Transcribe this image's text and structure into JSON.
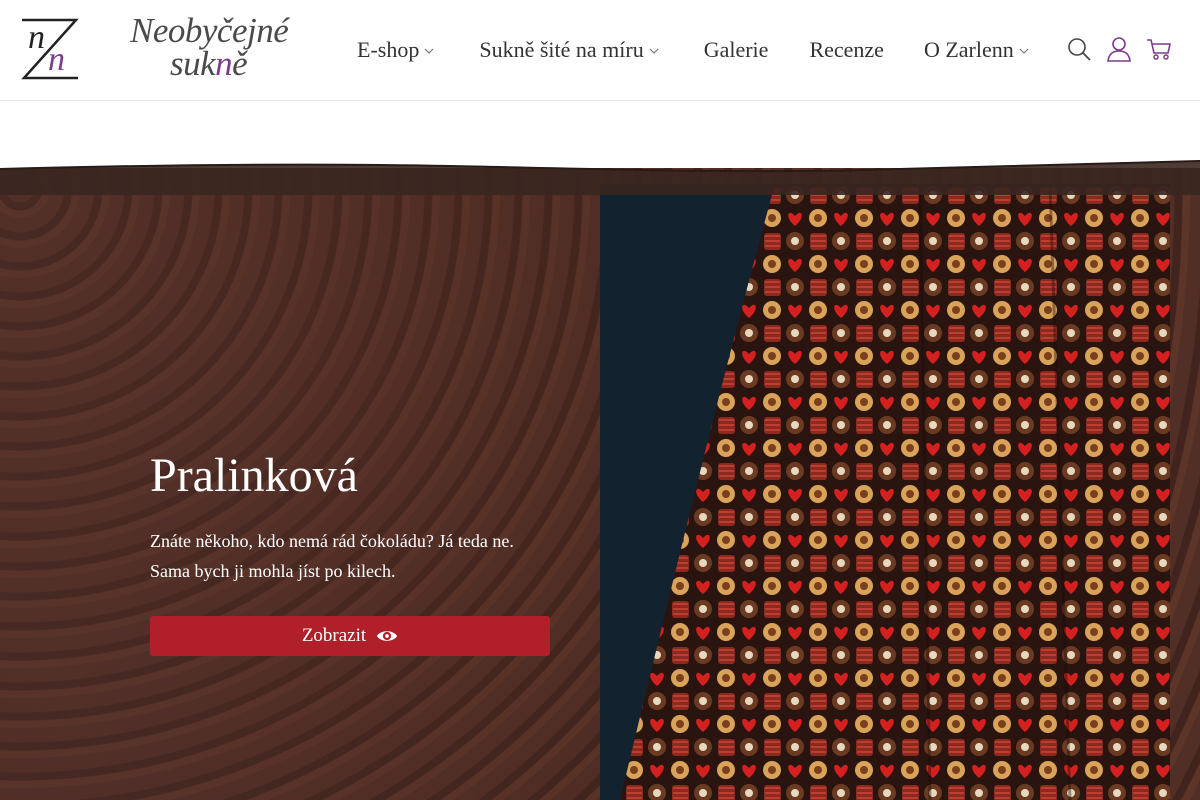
{
  "header": {
    "logo_monogram": "nZn",
    "logo_line1": "Neobyčejné",
    "logo_line2_pre": "suk",
    "logo_line2_accent": "n",
    "logo_line2_post": "ě",
    "nav": {
      "eshop": "E-shop",
      "sukne": "Sukně šité na míru",
      "galerie": "Galerie",
      "recenze": "Recenze",
      "zarlenn": "O Zarlenn"
    },
    "icons": [
      "search-icon",
      "user-icon",
      "cart-icon"
    ]
  },
  "hero": {
    "title": "Pralinková",
    "desc_line1": "Znáte někoho, kdo nemá rád čokoládu? Já teda ne.",
    "desc_line2": "Sama bych ji mohla jíst po kilech.",
    "button_label": "Zobrazit"
  },
  "colors": {
    "accent_purple": "#7a3d8c",
    "button_red": "#b11f2a",
    "product_bg": "#13222f"
  }
}
